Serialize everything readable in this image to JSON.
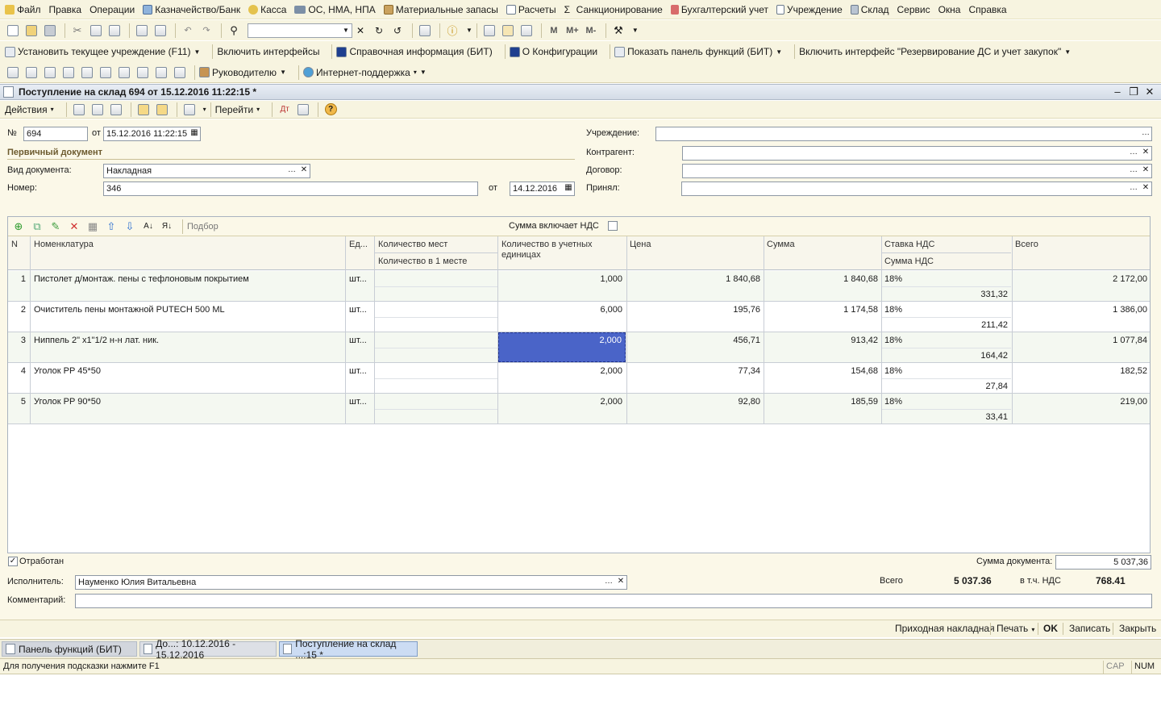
{
  "menu": {
    "items": [
      {
        "label": "Файл",
        "icon": "file-menu-icon"
      },
      {
        "label": "Правка",
        "icon": ""
      },
      {
        "label": "Операции",
        "icon": ""
      },
      {
        "label": "Казначейство/Банк",
        "icon": "bank-icon"
      },
      {
        "label": "Касса",
        "icon": "cash-icon"
      },
      {
        "label": "ОС, НМА, НПА",
        "icon": "truck-icon"
      },
      {
        "label": "Материальные запасы",
        "icon": "box-icon"
      },
      {
        "label": "Расчеты",
        "icon": "doc-icon"
      },
      {
        "label": "Санкционирование",
        "icon": "sigma-icon"
      },
      {
        "label": "Бухгалтерский учет",
        "icon": "ledger-icon"
      },
      {
        "label": "Учреждение",
        "icon": "institution-icon"
      },
      {
        "label": "Склад",
        "icon": "warehouse-icon"
      },
      {
        "label": "Сервис",
        "icon": ""
      },
      {
        "label": "Окна",
        "icon": ""
      },
      {
        "label": "Справка",
        "icon": ""
      }
    ]
  },
  "toolbar2": {
    "set_institution": "Установить текущее учреждение (F11)",
    "enable_interfaces": "Включить интерфейсы",
    "reference_info": "Справочная информация (БИТ)",
    "about_config": "О Конфигурации",
    "show_functions_panel": "Показать панель функций (БИТ)",
    "enable_reserve_interface": "Включить интерфейс \"Резервирование ДС и учет закупок\""
  },
  "toolbar3": {
    "manager": "Руководителю",
    "internet_support": "Интернет-поддержка"
  },
  "doc_window": {
    "title": "Поступление на склад 694 от 15.12.2016 11:22:15 *"
  },
  "doc_toolbar": {
    "actions": "Действия",
    "goto": "Перейти"
  },
  "header": {
    "number_label": "№",
    "number": "694",
    "from_label": "от",
    "date": "15.12.2016 11:22:15",
    "primary_doc_section": "Первичный документ",
    "doc_type_label": "Вид документа:",
    "doc_type": "Накладная",
    "doc_number_label": "Номер:",
    "doc_number": "346",
    "doc_date_from_label": "от",
    "doc_date": "14.12.2016",
    "institution_label": "Учреждение:",
    "institution": "",
    "counterparty_label": "Контрагент:",
    "counterparty": "",
    "contract_label": "Договор:",
    "contract": "",
    "accepted_label": "Принял:",
    "accepted": ""
  },
  "grid": {
    "select_label": "Подбор",
    "vat_included_label": "Сумма включает НДС",
    "vat_included": false,
    "columns": {
      "n": "N",
      "nomenclature": "Номенклатура",
      "unit": "Ед...",
      "places_count": "Количество мест",
      "qty_per_place": "Количество в 1 месте",
      "qty_units": "Количество в учетных единицах",
      "price": "Цена",
      "sum": "Сумма",
      "vat_rate": "Ставка НДС",
      "vat_sum": "Сумма НДС",
      "total": "Всего"
    },
    "rows": [
      {
        "n": "1",
        "name": "Пистолет д/монтаж. пены с тефлоновым покрытием",
        "unit": "шт...",
        "qty": "1,000",
        "price": "1 840,68",
        "sum": "1 840,68",
        "vat_rate": "18%",
        "vat_sum": "331,32",
        "total": "2 172,00"
      },
      {
        "n": "2",
        "name": "Очиститель пены монтажной PUTECH 500 ML",
        "unit": "шт...",
        "qty": "6,000",
        "price": "195,76",
        "sum": "1 174,58",
        "vat_rate": "18%",
        "vat_sum": "211,42",
        "total": "1 386,00"
      },
      {
        "n": "3",
        "name": "Ниппель 2\" х1\"1/2 н-н лат. ник.",
        "unit": "шт...",
        "qty": "2,000",
        "price": "456,71",
        "sum": "913,42",
        "vat_rate": "18%",
        "vat_sum": "164,42",
        "total": "1 077,84"
      },
      {
        "n": "4",
        "name": "Уголок PP 45*50",
        "unit": "шт...",
        "qty": "2,000",
        "price": "77,34",
        "sum": "154,68",
        "vat_rate": "18%",
        "vat_sum": "27,84",
        "total": "182,52"
      },
      {
        "n": "5",
        "name": "Уголок PP 90*50",
        "unit": "шт...",
        "qty": "2,000",
        "price": "92,80",
        "sum": "185,59",
        "vat_rate": "18%",
        "vat_sum": "33,41",
        "total": "219,00"
      }
    ]
  },
  "footer": {
    "processed_label": "Отработан",
    "processed": true,
    "doc_sum_label": "Сумма документа:",
    "doc_sum": "5 037,36",
    "executor_label": "Исполнитель:",
    "executor": "Науменко Юлия Витальевна",
    "total_label": "Всего",
    "total": "5 037.36",
    "vat_label": "в т.ч. НДС",
    "vat": "768.41",
    "comment_label": "Комментарий:",
    "comment": ""
  },
  "bottom_buttons": {
    "incoming_invoice": "Приходная накладная",
    "print": "Печать",
    "ok": "OK",
    "save": "Записать",
    "close": "Закрыть"
  },
  "taskbar": {
    "tasks": [
      "Панель функций (БИТ)",
      "До...: 10.12.2016 - 15.12.2016",
      "Поступление на склад ...:15 *"
    ]
  },
  "status": {
    "hint": "Для получения подсказки нажмите F1",
    "cap": "CAP",
    "num": "NUM"
  },
  "colors": {
    "selected_cell": "#4a64c8",
    "panel_bg": "#fbf8e8",
    "section_text": "#6c5a2e"
  }
}
